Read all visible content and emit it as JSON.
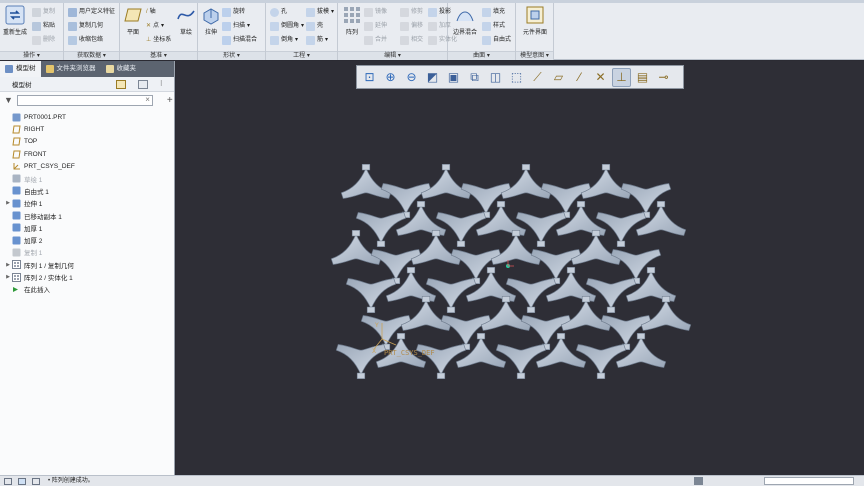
{
  "ribbon": {
    "groups": [
      {
        "label": "操作 ▾"
      },
      {
        "label": "获取数据 ▾"
      },
      {
        "label": "基准 ▾"
      },
      {
        "label": "形状 ▾"
      },
      {
        "label": "工程 ▾"
      },
      {
        "label": "编辑 ▾"
      },
      {
        "label": "曲面 ▾"
      },
      {
        "label": "模型意图 ▾"
      }
    ],
    "regenerate": "重新生成",
    "copy": "复制",
    "paste": "粘贴",
    "delete": "删除",
    "udf": "用户定义特征",
    "copy_geom": "复制几何",
    "shrinkwrap": "收缩包络",
    "plane": "平面",
    "axis": "轴",
    "point": "点",
    "csys": "坐标系",
    "sketch": "草绘",
    "extrude": "拉伸",
    "revolve": "旋转",
    "sweep": "扫描",
    "swept_blend": "扫描混合",
    "hole": "孔",
    "round": "倒圆角",
    "chamfer": "倒角",
    "draft": "拔模",
    "shell": "壳",
    "rib": "筋",
    "pattern": "阵列",
    "mirror": "镜像",
    "extend": "延伸",
    "trim": "修剪",
    "offset": "偏移",
    "merge": "合并",
    "intersect": "相交",
    "thicken": "加厚",
    "project": "投影",
    "solidify": "实体化",
    "boundary_blend": "边界混合",
    "fill": "填充",
    "style": "样式",
    "freestyle": "自由式",
    "component_interface": "元件界面"
  },
  "panel": {
    "tabs": [
      "模型树",
      "文件夹浏览器",
      "收藏夹"
    ],
    "header": "模型树",
    "filter_placeholder": "",
    "tree": [
      {
        "label": "PRT0001.PRT",
        "icon": "part-icon",
        "dim": false,
        "exp": ""
      },
      {
        "label": "RIGHT",
        "icon": "datum-plane-icon",
        "dim": false,
        "exp": ""
      },
      {
        "label": "TOP",
        "icon": "datum-plane-icon",
        "dim": false,
        "exp": ""
      },
      {
        "label": "FRONT",
        "icon": "datum-plane-icon",
        "dim": false,
        "exp": ""
      },
      {
        "label": "PRT_CSYS_DEF",
        "icon": "csys-icon",
        "dim": false,
        "exp": ""
      },
      {
        "label": "草绘 1",
        "icon": "sketch-icon",
        "dim": true,
        "exp": ""
      },
      {
        "label": "自由式 1",
        "icon": "freestyle-icon",
        "dim": false,
        "exp": ""
      },
      {
        "label": "拉伸 1",
        "icon": "extrude-icon",
        "dim": false,
        "exp": "▶"
      },
      {
        "label": "已移动副本 1",
        "icon": "moved-copy-icon",
        "dim": false,
        "exp": ""
      },
      {
        "label": "加厚 1",
        "icon": "thicken-icon",
        "dim": false,
        "exp": ""
      },
      {
        "label": "加厚 2",
        "icon": "thicken-icon",
        "dim": false,
        "exp": ""
      },
      {
        "label": "复制 1",
        "icon": "copy-icon",
        "dim": true,
        "exp": ""
      },
      {
        "label": "阵列 1 / 复制几何",
        "icon": "pattern-icon",
        "dim": false,
        "exp": "▶"
      },
      {
        "label": "阵列 2 / 实体化 1",
        "icon": "pattern-icon",
        "dim": false,
        "exp": "▶"
      },
      {
        "label": "在此插入",
        "icon": "insert-here-icon",
        "dim": false,
        "exp": ""
      }
    ]
  },
  "viewport": {
    "csys_label": "PRT_CSYS_DEF",
    "toolbar_icons": [
      "refit-icon",
      "zoom-in-icon",
      "zoom-out-icon",
      "repaint-icon",
      "display-style-icon",
      "saved-views-icon",
      "view-manager-icon",
      "perspective-icon",
      "datum-display-icon",
      "plane-display-icon",
      "axis-display-icon",
      "point-display-icon",
      "csys-display-icon",
      "annotation-display-icon",
      "spin-center-icon"
    ]
  },
  "status": {
    "message": "• 阵列创建成功。"
  },
  "colors": {
    "ribbon_bg": "#e9ecf1",
    "viewport_bg": "#2e2e36",
    "model_fill": "#bcc6d4",
    "model_shadow": "#7f8b9c",
    "panel_tab_bg": "#5c6470"
  }
}
